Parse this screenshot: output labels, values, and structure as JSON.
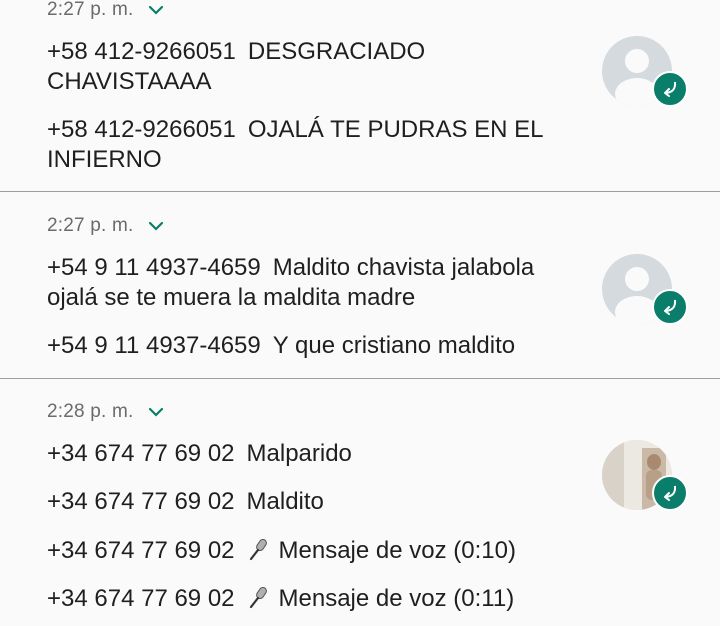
{
  "groups": [
    {
      "time": "2:27 p. m.",
      "messages": [
        {
          "sender": "+58 412-9266051",
          "text": "DESGRACIADO CHAVISTAAAA"
        },
        {
          "sender": "+58 412-9266051",
          "text": "OJALÁ TE PUDRAS EN EL INFIERNO"
        }
      ]
    },
    {
      "time": "2:27 p. m.",
      "messages": [
        {
          "sender": "+54 9 11 4937-4659",
          "text": "Maldito chavista jalabola ojalá se te muera la maldita madre"
        },
        {
          "sender": "+54 9 11 4937-4659",
          "text": "Y que cristiano maldito"
        }
      ]
    },
    {
      "time": "2:28 p. m.",
      "messages": [
        {
          "sender": "+34 674 77 69 02",
          "text": "Malparido"
        },
        {
          "sender": "+34 674 77 69 02",
          "text": "Maldito"
        },
        {
          "sender": "+34 674 77 69 02",
          "text": "Mensaje de voz (0:10)",
          "icon": "microphone-icon"
        },
        {
          "sender": "+34 674 77 69 02",
          "text": "Mensaje de voz (0:11)",
          "icon": "microphone-icon"
        }
      ]
    }
  ],
  "colors": {
    "accent": "#0b7d6b",
    "time": "#6b6b6b",
    "divider": "#9e9e9e",
    "avatar_placeholder": "#d4dade"
  },
  "icons": {
    "expand": "chevron-down-icon",
    "reply": "reply-icon",
    "avatar": "default-contact-avatar-icon"
  }
}
